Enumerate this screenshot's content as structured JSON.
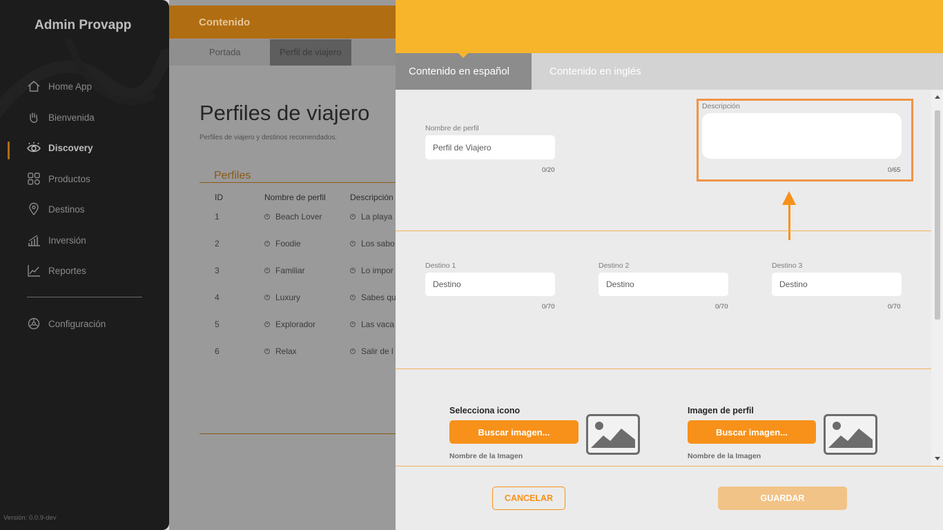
{
  "sidebar": {
    "brand": "Admin Provapp",
    "items": [
      {
        "label": "Home App",
        "icon": "home-icon"
      },
      {
        "label": "Bienvenida",
        "icon": "hand-wave-icon"
      },
      {
        "label": "Discovery",
        "icon": "eye-icon",
        "active": true
      },
      {
        "label": "Productos",
        "icon": "grid-icon"
      },
      {
        "label": "Destinos",
        "icon": "location-pin-icon"
      },
      {
        "label": "Inversión",
        "icon": "bar-chart-icon"
      },
      {
        "label": "Reportes",
        "icon": "line-chart-icon"
      }
    ],
    "settings": {
      "label": "Configuración",
      "icon": "gear-icon"
    },
    "version": "Versión: 0.0.9-dev"
  },
  "main": {
    "section": "Contenido",
    "tabs": [
      "Portada",
      "Perfil de viajero"
    ],
    "title": "Perfiles de viajero",
    "subtitle": "Perfiles de viajero y destinos recomendados.",
    "table_title": "Perfiles",
    "columns": [
      "ID",
      "Nombre de perfil",
      "Descripción"
    ],
    "rows": [
      {
        "id": "1",
        "name": "Beach Lover",
        "desc": "La playa"
      },
      {
        "id": "2",
        "name": "Foodie",
        "desc": "Los sabo"
      },
      {
        "id": "3",
        "name": "Familiar",
        "desc": "Lo impor"
      },
      {
        "id": "4",
        "name": "Luxury",
        "desc": "Sabes qu"
      },
      {
        "id": "5",
        "name": "Explorador",
        "desc": "Las vaca"
      },
      {
        "id": "6",
        "name": "Relax",
        "desc": "Salir de l"
      }
    ]
  },
  "panel": {
    "tabs": [
      "Contenido en español",
      "Contenido en inglés"
    ],
    "profile_name": {
      "label": "Nombre de perfil",
      "value": "Perfil de Viajero",
      "counter": "0/20"
    },
    "description": {
      "label": "Descripción",
      "value": "",
      "counter": "0/65"
    },
    "destinations": [
      {
        "label": "Destino 1",
        "placeholder": "Destino",
        "counter": "0/70"
      },
      {
        "label": "Destino 2",
        "placeholder": "Destino",
        "counter": "0/70"
      },
      {
        "label": "Destino 3",
        "placeholder": "Destino",
        "counter": "0/70"
      }
    ],
    "icon_section": {
      "title": "Selecciona icono",
      "button": "Buscar imagen...",
      "image_name": "Nombre de la Imagen"
    },
    "profile_image_section": {
      "title": "Imagen de perfil",
      "button": "Buscar imagen...",
      "image_name": "Nombre de la Imagen"
    },
    "cancel": "CANCELAR",
    "save": "GUARDAR"
  },
  "colors": {
    "accent": "#f7b52b",
    "button_orange": "#f7911a",
    "highlight": "#ef9446",
    "sidebar": "#1c1c1c"
  }
}
